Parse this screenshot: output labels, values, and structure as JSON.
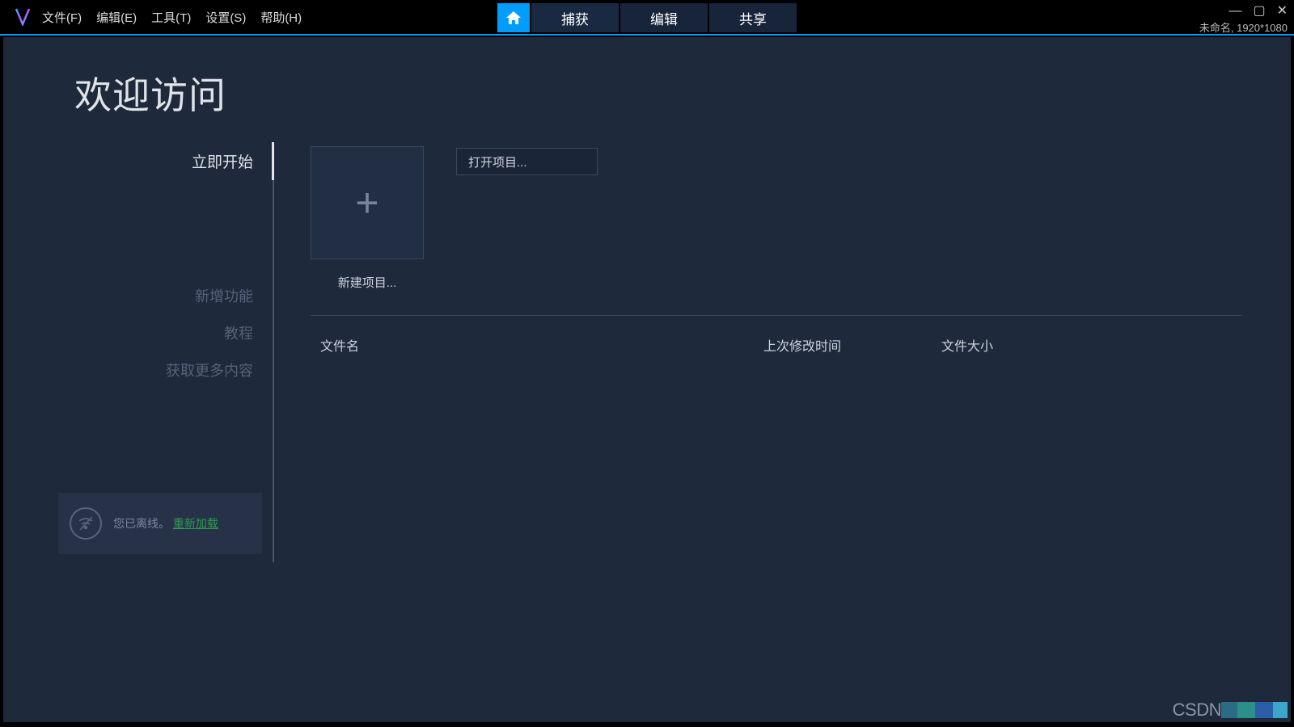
{
  "menubar": {
    "file": "文件(F)",
    "edit": "编辑(E)",
    "tools": "工具(T)",
    "settings": "设置(S)",
    "help": "帮助(H)"
  },
  "modeTabs": {
    "capture": "捕获",
    "edit": "编辑",
    "share": "共享"
  },
  "statusLabel": "未命名, 1920*1080",
  "welcome": {
    "title": "欢迎访问"
  },
  "sidebar": {
    "getStarted": "立即开始",
    "whatsNew": "新增功能",
    "tutorials": "教程",
    "getMore": "获取更多内容"
  },
  "offline": {
    "text": "您已离线。",
    "link": "重新加载"
  },
  "content": {
    "newProject": "新建项目...",
    "openProject": "打开项目..."
  },
  "table": {
    "filename": "文件名",
    "modified": "上次修改时间",
    "size": "文件大小"
  },
  "watermark": "CSDN"
}
